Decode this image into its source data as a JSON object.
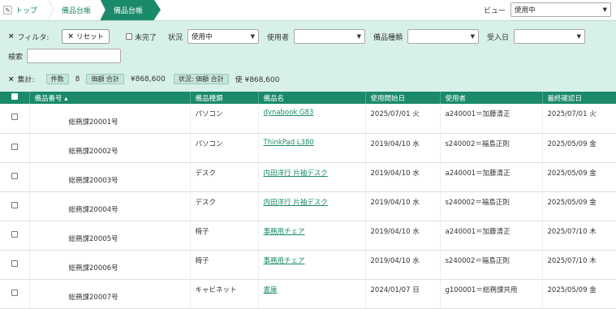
{
  "breadcrumb": {
    "home": "トップ",
    "items": [
      "備品台帳",
      "備品台帳"
    ]
  },
  "view": {
    "label": "ビュー",
    "selected": "使用中"
  },
  "filter": {
    "title": "フィルタ:",
    "reset": "リセット",
    "incomplete": "未完了",
    "status_label": "状況",
    "status_value": "使用中",
    "user_label": "使用者",
    "type_label": "備品種類",
    "date_label": "受入日",
    "search_label": "検索"
  },
  "summary": {
    "title": "集計:",
    "count_label": "件数",
    "count_value": "8",
    "amount_label": "価額 合計",
    "amount_value": "¥868,600",
    "status_amount_label": "状況: 価額 合計",
    "status_amount_value": "使 ¥868,600"
  },
  "table": {
    "headers": [
      "備品番号 ▴",
      "備品種類",
      "備品名",
      "使用開始日",
      "使用者",
      "最終確認日"
    ],
    "rows": [
      [
        "総務課20001号",
        "パソコン",
        "dynabook G83",
        "2025/07/01 火",
        "a240001＝加藤清正",
        "2025/07/01 火"
      ],
      [
        "総務課20002号",
        "パソコン",
        "ThinkPad L380",
        "2019/04/10 水",
        "s240002＝福島正則",
        "2025/05/09 金"
      ],
      [
        "総務課20003号",
        "デスク",
        "内田洋行 片袖デスク",
        "2019/04/10 水",
        "a240001＝加藤清正",
        "2025/05/09 金"
      ],
      [
        "総務課20004号",
        "デスク",
        "内田洋行 片袖デスク",
        "2019/04/10 水",
        "s240002＝福島正則",
        "2025/05/09 金"
      ],
      [
        "総務課20005号",
        "椅子",
        "事務用チェア",
        "2019/04/10 水",
        "a240001＝加藤清正",
        "2025/07/10 木"
      ],
      [
        "総務課20006号",
        "椅子",
        "事務用チェア",
        "2019/04/10 水",
        "s240002＝福島正則",
        "2025/07/10 木"
      ],
      [
        "総務課20007号",
        "キャビネット",
        "書庫",
        "2024/01/07 日",
        "g100001＝総務課共用",
        "2025/05/09 金"
      ]
    ]
  },
  "colors": {
    "accent": "#1a8a6a",
    "panel": "#d8f1e8"
  }
}
